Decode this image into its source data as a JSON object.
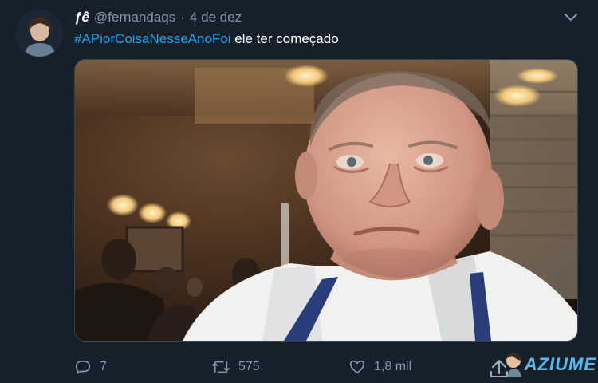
{
  "tweet": {
    "display_name": "ƒê",
    "handle": "@fernandaqs",
    "separator": "·",
    "date": "4 de dez",
    "hashtag": "#APiorCoisaNesseAnoFoi",
    "text": " ele ter começado",
    "avatar_icon": "profile-photo",
    "menu_icon": "chevron-down-icon"
  },
  "actions": {
    "reply_count": "7",
    "retweet_count": "575",
    "like_count": "1,8 mil",
    "share_icon": "share-icon"
  },
  "watermark": {
    "text": "AZIUME"
  },
  "colors": {
    "background": "#15202b",
    "accent": "#1da1f2",
    "muted": "#8899a6"
  }
}
